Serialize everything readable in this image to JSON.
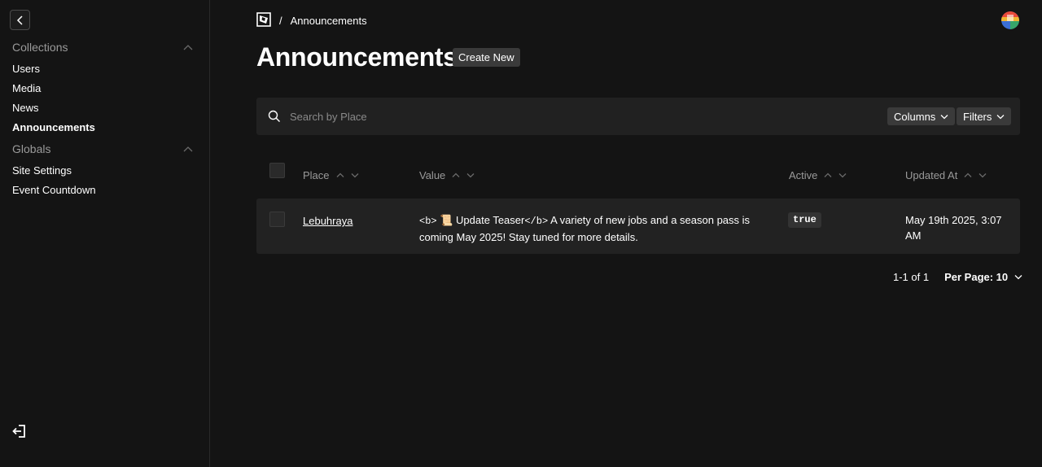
{
  "sidebar": {
    "groups": [
      {
        "label": "Collections",
        "items": [
          {
            "label": "Users"
          },
          {
            "label": "Media"
          },
          {
            "label": "News"
          },
          {
            "label": "Announcements"
          }
        ]
      },
      {
        "label": "Globals",
        "items": [
          {
            "label": "Site Settings"
          },
          {
            "label": "Event Countdown"
          }
        ]
      }
    ]
  },
  "breadcrumb": {
    "separator": "/",
    "current": "Announcements"
  },
  "header": {
    "title": "Announcements",
    "create_label": "Create New"
  },
  "search": {
    "placeholder": "Search by Place",
    "columns_label": "Columns",
    "filters_label": "Filters"
  },
  "table": {
    "columns": [
      "Place",
      "Value",
      "Active",
      "Updated At"
    ],
    "rows": [
      {
        "place": "Lebuhraya",
        "value_open_tag": "<b>",
        "value_emoji": "📜",
        "value_text": " Update Teaser",
        "value_close_tag": "</b>",
        "value_rest": " A variety of new jobs and a season pass is coming May 2025! Stay tuned for more details.",
        "active": "true",
        "updated_at": "May 19th 2025, 3:07 AM"
      }
    ]
  },
  "pagination": {
    "range": "1-1 of 1",
    "per_page_label": "Per Page: 10"
  }
}
